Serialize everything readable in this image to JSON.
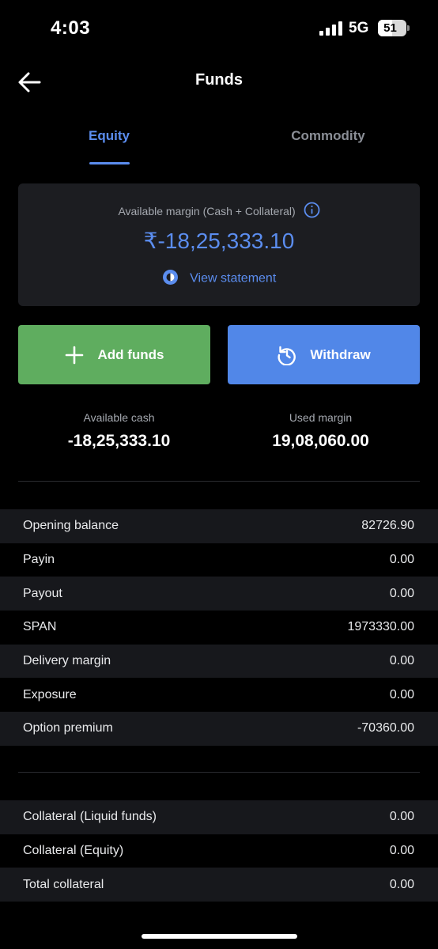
{
  "status_bar": {
    "time": "4:03",
    "network": "5G",
    "battery": "51",
    "battery_level": 0.51
  },
  "header": {
    "title": "Funds"
  },
  "tabs": [
    {
      "label": "Equity",
      "active": true
    },
    {
      "label": "Commodity",
      "active": false
    }
  ],
  "margin_card": {
    "label": "Available margin (Cash + Collateral)",
    "value": "₹-18,25,333.10",
    "view_statement": "View statement"
  },
  "actions": {
    "add_funds": "Add funds",
    "withdraw": "Withdraw"
  },
  "summary": {
    "available_cash_label": "Available cash",
    "available_cash_value": "-18,25,333.10",
    "used_margin_label": "Used margin",
    "used_margin_value": "19,08,060.00"
  },
  "breakdown": [
    {
      "label": "Opening balance",
      "value": "82726.90"
    },
    {
      "label": "Payin",
      "value": "0.00"
    },
    {
      "label": "Payout",
      "value": "0.00"
    },
    {
      "label": "SPAN",
      "value": "1973330.00"
    },
    {
      "label": "Delivery margin",
      "value": "0.00"
    },
    {
      "label": "Exposure",
      "value": "0.00"
    },
    {
      "label": "Option premium",
      "value": "-70360.00"
    }
  ],
  "collateral": [
    {
      "label": "Collateral (Liquid funds)",
      "value": "0.00"
    },
    {
      "label": "Collateral (Equity)",
      "value": "0.00"
    },
    {
      "label": "Total collateral",
      "value": "0.00"
    }
  ],
  "colors": {
    "accent": "#5b8def",
    "add_button": "#5fad5f",
    "withdraw_button": "#5187e8",
    "background": "#000000",
    "card": "#1c1d21"
  },
  "icons": {
    "back": "arrow-left-icon",
    "info": "info-icon",
    "statement": "statement-icon",
    "add": "plus-icon",
    "withdraw": "refresh-icon"
  }
}
